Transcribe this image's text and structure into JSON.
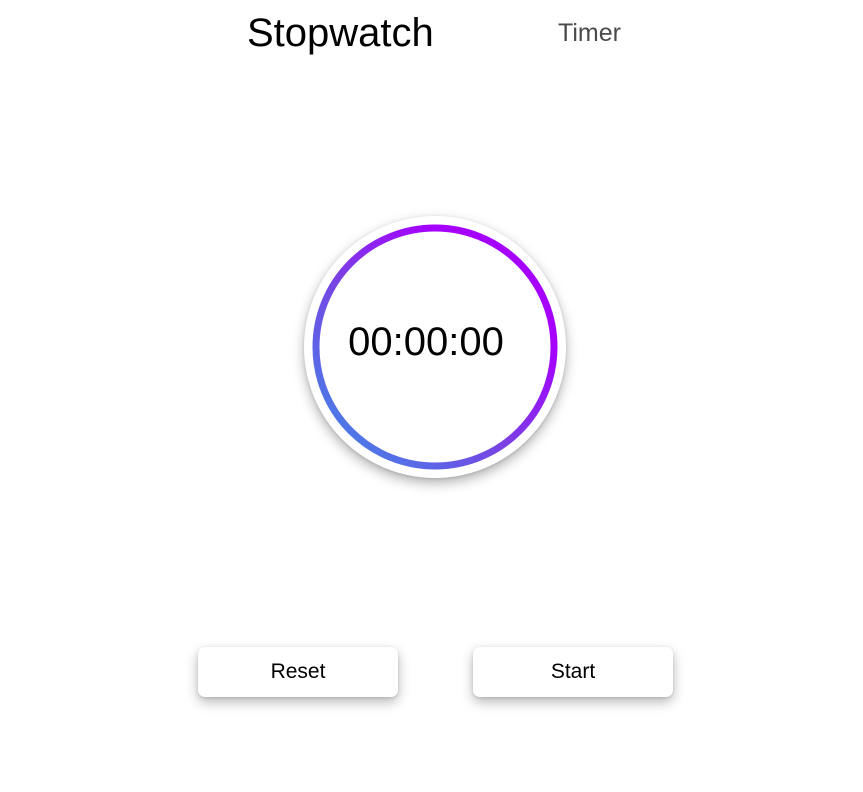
{
  "tabs": {
    "active": "Stopwatch",
    "inactive": "Timer"
  },
  "stopwatch": {
    "time": "00:00:00"
  },
  "controls": {
    "reset_label": "Reset",
    "start_label": "Start"
  },
  "colors": {
    "ring_gradient_start": "#3b8fe8",
    "ring_gradient_mid": "#7b3fe4",
    "ring_gradient_end": "#a600ff",
    "background": "#ffffff"
  }
}
